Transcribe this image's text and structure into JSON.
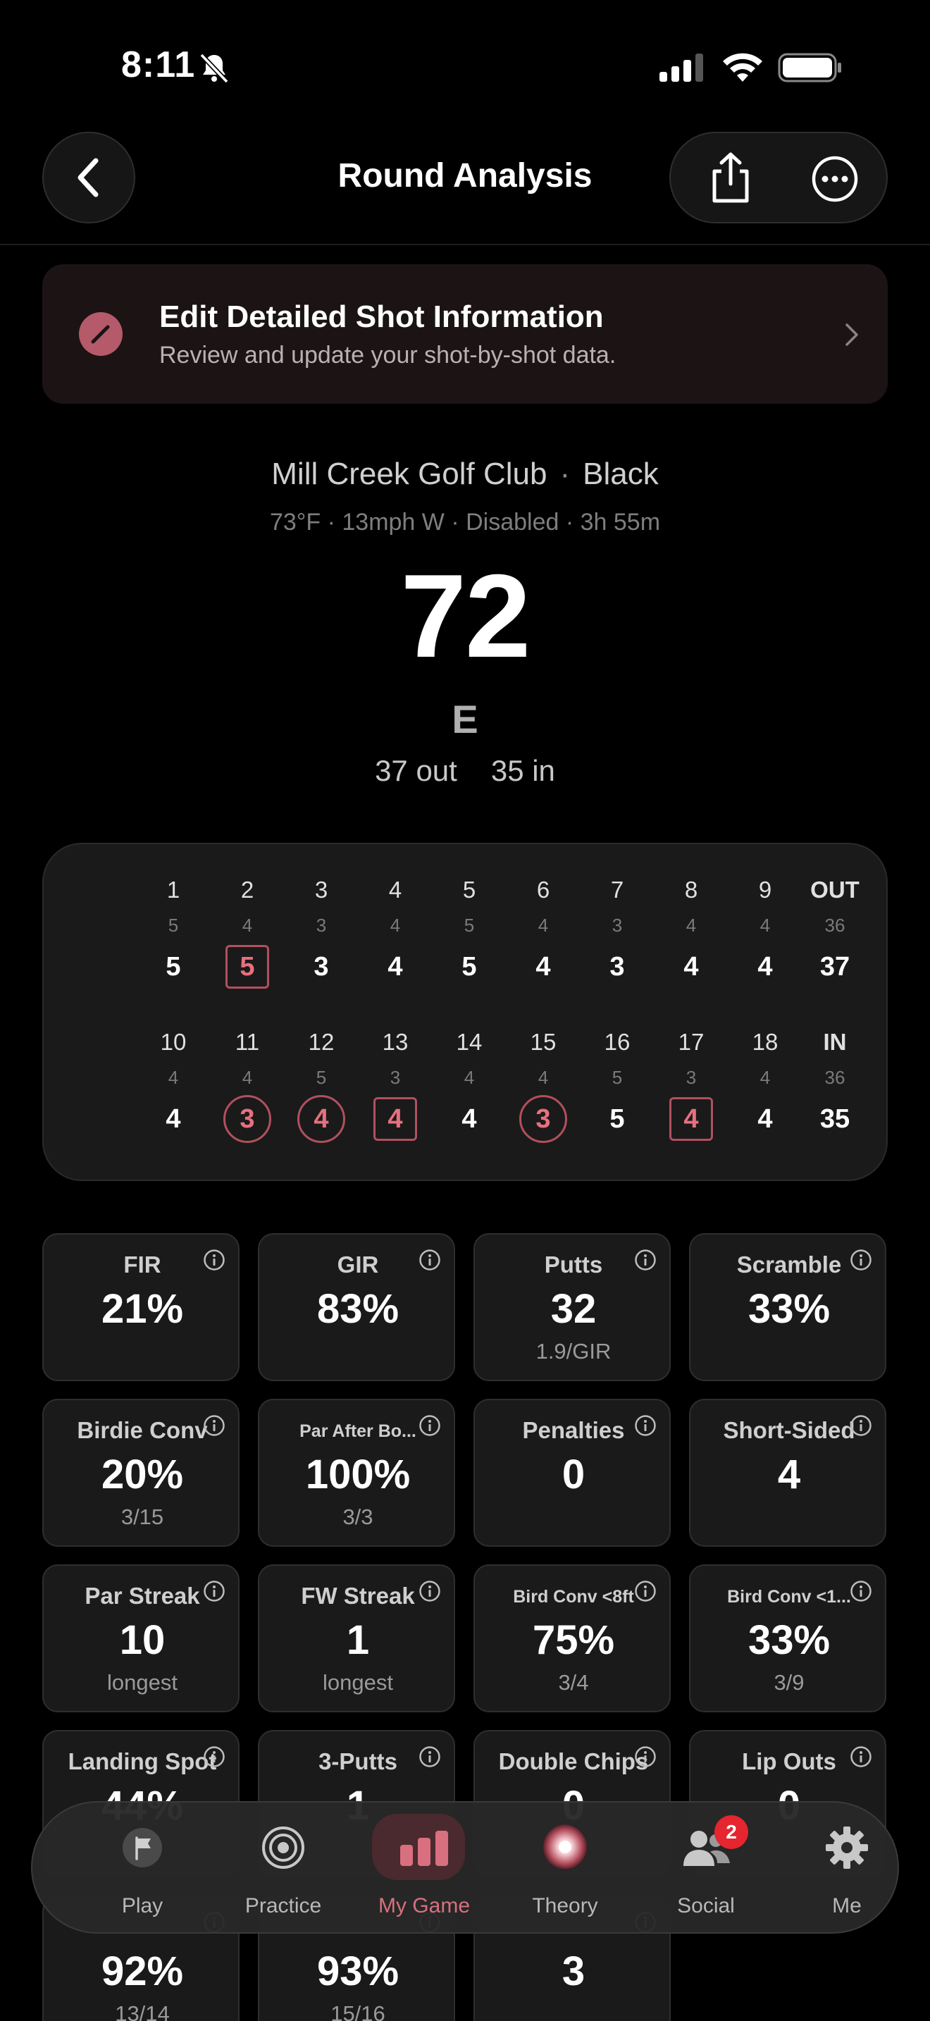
{
  "status_bar": {
    "time": "8:11"
  },
  "nav": {
    "title": "Round Analysis"
  },
  "edit_banner": {
    "title": "Edit Detailed Shot Information",
    "subtitle": "Review and update your shot-by-shot data."
  },
  "round": {
    "course": "Mill Creek Golf Club",
    "separator": "·",
    "tees": "Black",
    "conditions": "73°F · 13mph W · Disabled · 3h 55m",
    "score": "72",
    "to_par": "E",
    "out": "37 out",
    "in": "35 in"
  },
  "scorecard": {
    "front": {
      "holes": [
        "1",
        "2",
        "3",
        "4",
        "5",
        "6",
        "7",
        "8",
        "9",
        "OUT"
      ],
      "pars": [
        "5",
        "4",
        "3",
        "4",
        "5",
        "4",
        "3",
        "4",
        "4",
        "36"
      ],
      "scores": [
        "5",
        "5",
        "3",
        "4",
        "5",
        "4",
        "3",
        "4",
        "4",
        "37"
      ],
      "marks": [
        "",
        "box",
        "",
        "",
        "",
        "",
        "",
        "",
        "",
        ""
      ]
    },
    "back": {
      "holes": [
        "10",
        "11",
        "12",
        "13",
        "14",
        "15",
        "16",
        "17",
        "18",
        "IN"
      ],
      "pars": [
        "4",
        "4",
        "5",
        "3",
        "4",
        "4",
        "5",
        "3",
        "4",
        "36"
      ],
      "scores": [
        "4",
        "3",
        "4",
        "4",
        "4",
        "3",
        "5",
        "4",
        "4",
        "35"
      ],
      "marks": [
        "",
        "circle",
        "circle",
        "box",
        "",
        "circle",
        "",
        "box",
        "",
        ""
      ]
    },
    "mark_color": "#b0505e"
  },
  "stats": [
    {
      "label": "FIR",
      "value": "21%",
      "sub": ""
    },
    {
      "label": "GIR",
      "value": "83%",
      "sub": ""
    },
    {
      "label": "Putts",
      "value": "32",
      "sub": "1.9/GIR"
    },
    {
      "label": "Scramble",
      "value": "33%",
      "sub": ""
    },
    {
      "label": "Birdie Conv",
      "value": "20%",
      "sub": "3/15"
    },
    {
      "label": "Par After Bo...",
      "value": "100%",
      "sub": "3/3"
    },
    {
      "label": "Penalties",
      "value": "0",
      "sub": ""
    },
    {
      "label": "Short-Sided",
      "value": "4",
      "sub": ""
    },
    {
      "label": "Par Streak",
      "value": "10",
      "sub": "longest"
    },
    {
      "label": "FW Streak",
      "value": "1",
      "sub": "longest"
    },
    {
      "label": "Bird Conv <8ft",
      "value": "75%",
      "sub": "3/4"
    },
    {
      "label": "Bird Conv <1...",
      "value": "33%",
      "sub": "3/9"
    },
    {
      "label": "Landing Spot",
      "value": "44%",
      "sub": ""
    },
    {
      "label": "3-Putts",
      "value": "1",
      "sub": ""
    },
    {
      "label": "Double Chips",
      "value": "0",
      "sub": ""
    },
    {
      "label": "Lip Outs",
      "value": "0",
      "sub": ""
    },
    {
      "label": "",
      "value": "92%",
      "sub": "13/14"
    },
    {
      "label": "",
      "value": "93%",
      "sub": "15/16"
    },
    {
      "label": "",
      "value": "3",
      "sub": ""
    }
  ],
  "tabs": [
    {
      "label": "Play",
      "icon": "flag-icon"
    },
    {
      "label": "Practice",
      "icon": "target-icon"
    },
    {
      "label": "My Game",
      "icon": "bar-chart-icon",
      "active": true
    },
    {
      "label": "Theory",
      "icon": "theory-orb-icon"
    },
    {
      "label": "Social",
      "icon": "people-icon",
      "badge": "2"
    },
    {
      "label": "Me",
      "icon": "gear-icon"
    }
  ],
  "colors": {
    "accent": "#d8707f",
    "background": "#000000",
    "card": "#1a1a1a",
    "badge": "#e5252f"
  }
}
